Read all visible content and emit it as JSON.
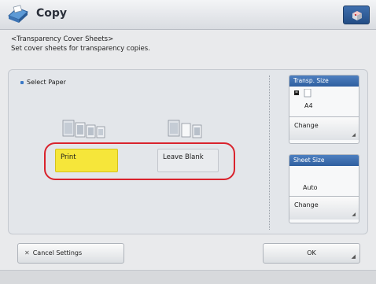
{
  "header": {
    "title": "Copy",
    "app_icon": "copy-icon",
    "corner_icon": "cube-icon"
  },
  "description": {
    "line1": "<Transparency Cover Sheets>",
    "line2": "Set cover sheets for transparency copies."
  },
  "select_paper": {
    "label": "Select Paper",
    "options": [
      {
        "label": "Print",
        "selected": true,
        "icon": "printed-sheets-icon"
      },
      {
        "label": "Leave Blank",
        "selected": false,
        "icon": "blank-sheets-icon"
      }
    ]
  },
  "transp_size": {
    "header": "Transp. Size",
    "value": "A4",
    "change_label": "Change"
  },
  "sheet_size": {
    "header": "Sheet Size",
    "value": "Auto",
    "change_label": "Change"
  },
  "footer": {
    "cancel_label": "Cancel Settings",
    "ok_label": "OK"
  },
  "colors": {
    "selected": "#f6e63a",
    "highlight": "#d9232d",
    "header_blue": "#2f5f9f"
  }
}
